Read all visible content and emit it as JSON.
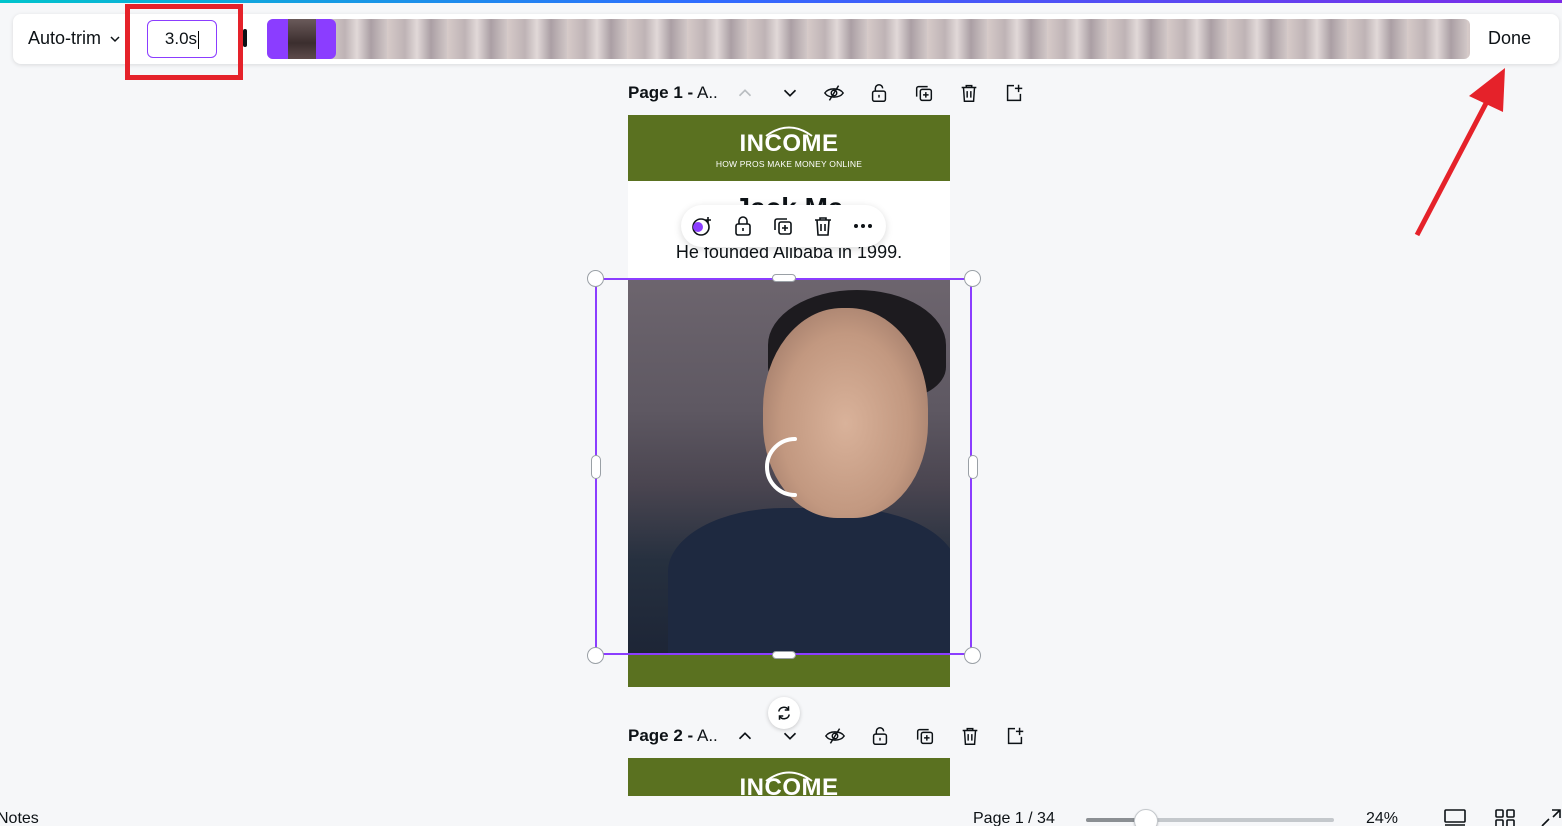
{
  "trim_toolbar": {
    "autotrim_label": "Auto-trim",
    "duration_value": "3.0s",
    "done_label": "Done"
  },
  "pages": [
    {
      "label_bold": "Page 1 -",
      "label_rest": " A.."
    },
    {
      "label_bold": "Page 2 -",
      "label_rest": " A.."
    }
  ],
  "design": {
    "logo": "INCOME",
    "tagline": "HOW PROS MAKE MONEY ONLINE",
    "title_partial": "Jack Ma",
    "caption": "He founded Alibaba in 1999."
  },
  "footer": {
    "notes_label": "Notes",
    "page_count": "Page 1 / 34",
    "zoom_level": "24%",
    "zoom_fraction": 0.24
  },
  "colors": {
    "accent": "#8b3dff",
    "brand_green": "#5a7120",
    "annotation_red": "#e5222a"
  },
  "icons": {
    "page_header": [
      "chevron-up-icon",
      "chevron-down-icon",
      "hide-icon",
      "lock-icon",
      "duplicate-icon",
      "trash-icon",
      "add-page-icon"
    ],
    "context_toolbar": [
      "comment-add-icon",
      "lock-icon",
      "duplicate-icon",
      "trash-icon",
      "more-icon"
    ],
    "footer": [
      "desktop-view-icon",
      "grid-view-icon",
      "fullscreen-icon"
    ]
  }
}
